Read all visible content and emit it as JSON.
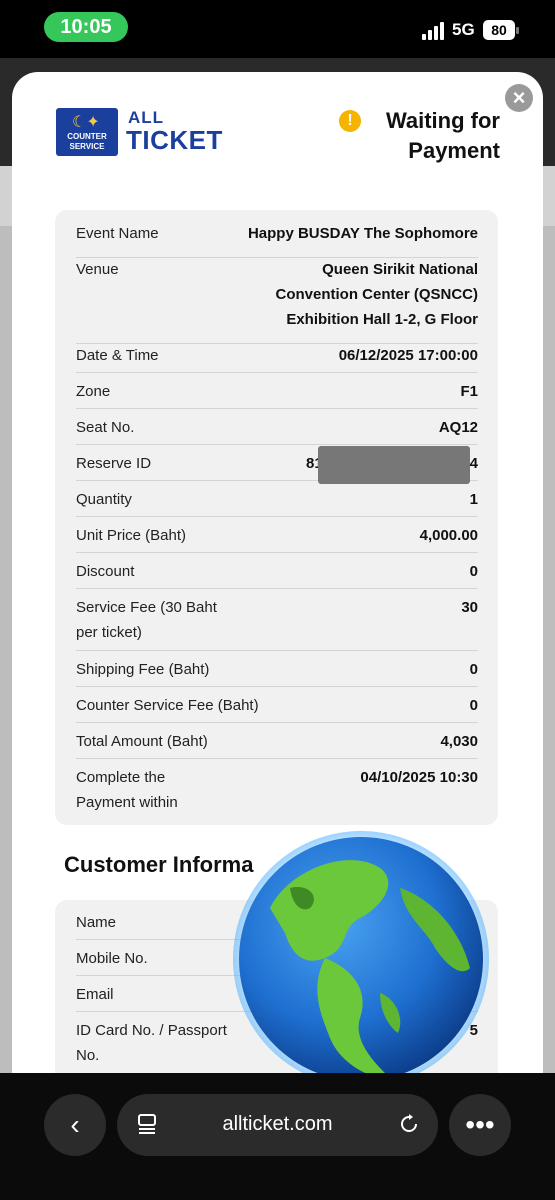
{
  "status_bar": {
    "time": "10:05",
    "network": "5G",
    "battery": "80"
  },
  "modal": {
    "logo": {
      "badge_line1": "COUNTER",
      "badge_line2": "SERVICE",
      "brand_top": "ALL",
      "brand_bottom": "TICKET"
    },
    "status": {
      "line1": "Waiting for",
      "line2": "Payment"
    },
    "details": [
      {
        "label": "Event Name",
        "value": "Happy BUSDAY The Sophomore"
      },
      {
        "label": "Venue",
        "value_lines": [
          "Queen Sirikit National",
          "Convention Center (QSNCC)",
          "Exhibition Hall 1-2, G Floor"
        ]
      },
      {
        "label": "Date & Time",
        "value": "06/12/2025 17:00:00"
      },
      {
        "label": "Zone",
        "value": "F1"
      },
      {
        "label": "Seat No.",
        "value": "AQ12"
      },
      {
        "label": "Reserve ID",
        "value_prefix": "810",
        "value_suffix": "4"
      },
      {
        "label": "Quantity",
        "value": "1"
      },
      {
        "label": "Unit Price (Baht)",
        "value": "4,000.00"
      },
      {
        "label": "Discount",
        "value": "0"
      },
      {
        "label_lines": [
          "Service Fee (30 Baht",
          "per ticket)"
        ],
        "value": "30"
      },
      {
        "label": "Shipping Fee (Baht)",
        "value": "0"
      },
      {
        "label": "Counter Service Fee (Baht)",
        "value": "0"
      },
      {
        "label": "Total Amount (Baht)",
        "value": "4,030"
      },
      {
        "label_lines": [
          "Complete the",
          "Payment within"
        ],
        "value": "04/10/2025 10:30"
      }
    ],
    "customer": {
      "title": "Customer Informa",
      "rows": [
        {
          "label": "Name"
        },
        {
          "label": "Mobile No."
        },
        {
          "label": "Email"
        },
        {
          "label_lines": [
            "ID Card No. / Passport",
            "No."
          ],
          "value_fragment": "5"
        }
      ]
    }
  },
  "browser": {
    "url": "allticket.com"
  },
  "colors": {
    "brand_blue": "#1b3f9c",
    "warning": "#f5b400",
    "status_green": "#35c759"
  }
}
